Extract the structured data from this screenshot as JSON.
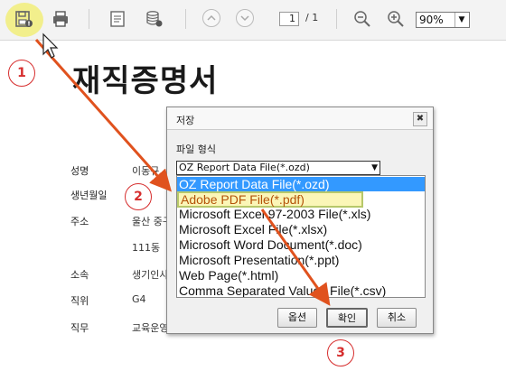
{
  "toolbar": {
    "icons": [
      "save-icon",
      "print-icon",
      "document-icon",
      "database-export-icon",
      "prev-page-icon",
      "next-page-icon",
      "zoom-out-icon",
      "zoom-in-icon"
    ],
    "page_current": "1",
    "page_sep": "/ 1",
    "zoom_value": "90%"
  },
  "document": {
    "title": "재직증명서",
    "rows": [
      {
        "label": "성명",
        "value": "이동규"
      },
      {
        "label": "생년월일",
        "value": ""
      },
      {
        "label": "주소",
        "value": "울산 중구"
      },
      {
        "label": "",
        "value": "111동"
      },
      {
        "label": "소속",
        "value": "생기인사"
      },
      {
        "label": "직위",
        "value": "G4"
      },
      {
        "label": "직무",
        "value": "교육운영"
      }
    ]
  },
  "dialog": {
    "title": "저장",
    "close": "✖",
    "format_label": "파일 형식",
    "selected_format": "OZ Report Data File(*.ozd)",
    "options": [
      "OZ Report Data File(*.ozd)",
      "Adobe PDF File(*.pdf)",
      "Microsoft Excel 97-2003 File(*.xls)",
      "Microsoft Excel File(*.xlsx)",
      "Microsoft Word Document(*.doc)",
      "Microsoft Presentation(*.ppt)",
      "Web Page(*.html)",
      "Comma Separated Values File(*.csv)"
    ],
    "buttons": {
      "options": "옵션",
      "ok": "확인",
      "cancel": "취소"
    }
  },
  "annotations": {
    "step1": "1",
    "step2": "2",
    "step3": "3",
    "color": "#e0521e"
  }
}
